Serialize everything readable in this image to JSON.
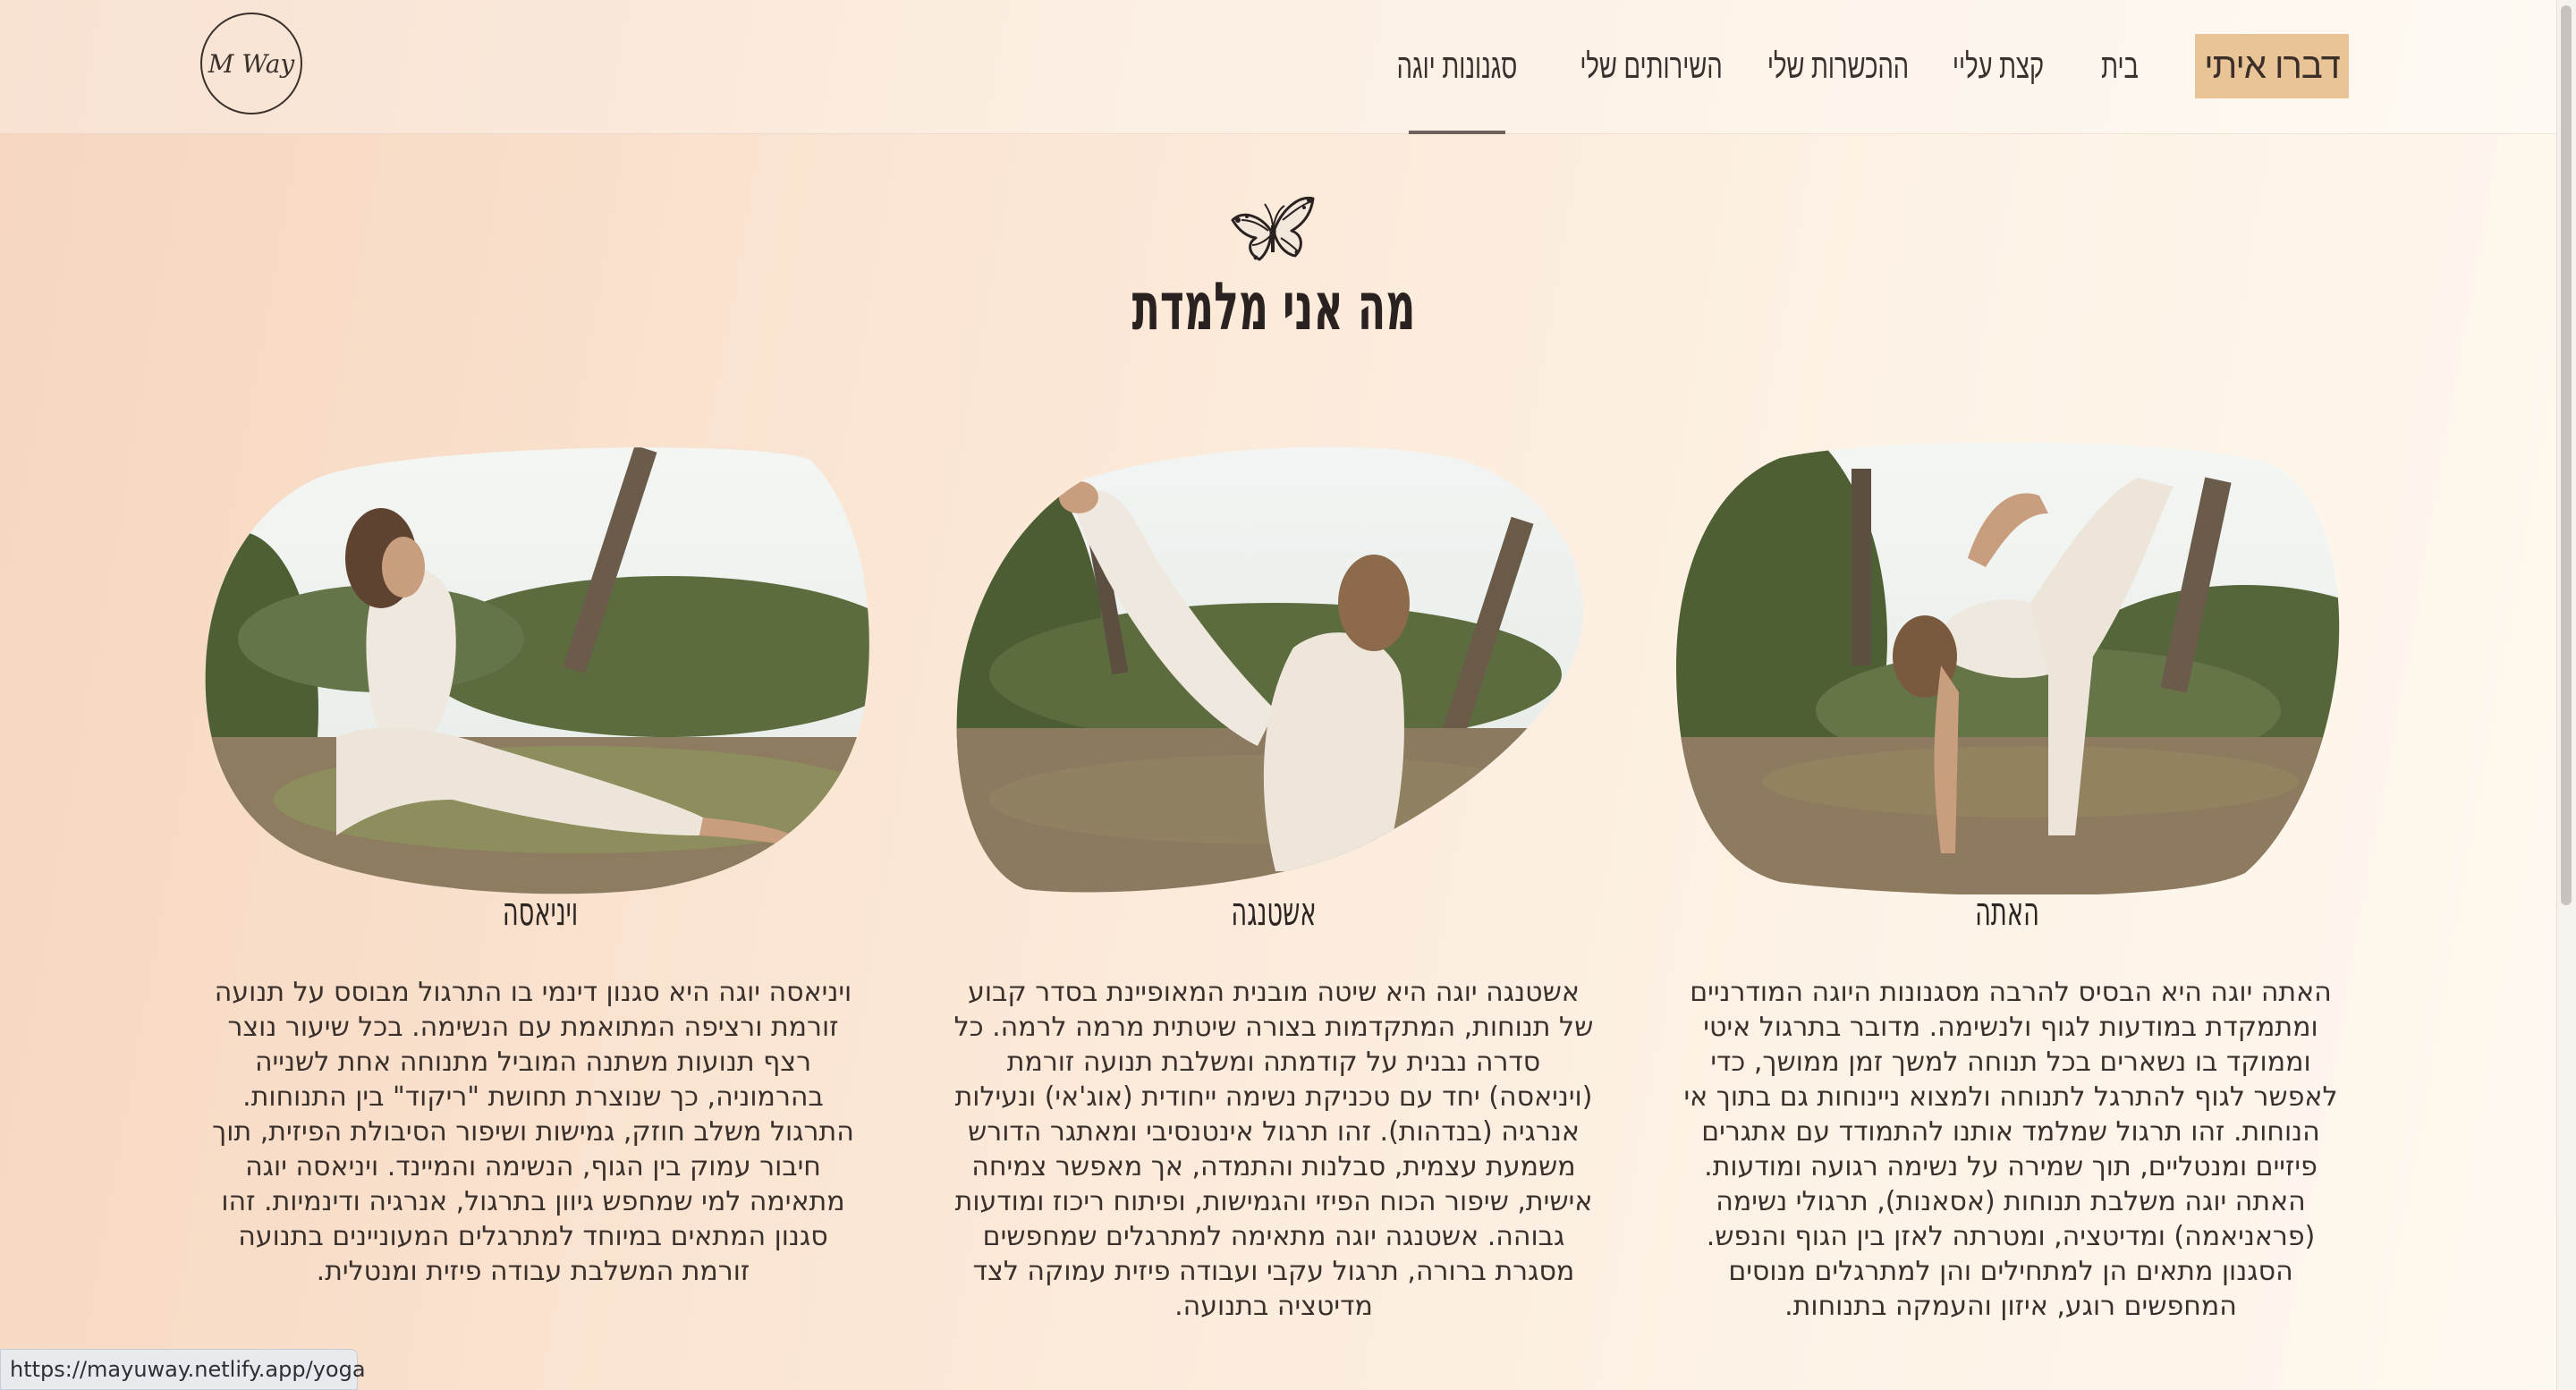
{
  "header": {
    "logo_text": "M Way",
    "cta_label": "דברו איתי",
    "nav": [
      {
        "label": "בית"
      },
      {
        "label": "קצת עליי"
      },
      {
        "label": "ההכשרות שלי"
      },
      {
        "label": "השירותים שלי"
      },
      {
        "label": "סגנונות יוגה",
        "active": true
      }
    ]
  },
  "section": {
    "title": "מה אני מלמדת",
    "icon": "butterfly-icon"
  },
  "cards": [
    {
      "title": "האתה",
      "image": "yoga-standing-pose-photo",
      "lines": [
        "האתה יוגה היא הבסיס להרבה מסגנונות היוגה המודרניים",
        "ומתמקדת במודעות לגוף ולנשימה. מדובר בתרגול איטי",
        "וממוקד בו נשארים בכל תנוחה למשך זמן ממושך, כדי",
        "לאפשר לגוף להתרגל לתנוחה ולמצוא ניינוחות גם בתוך אי",
        "הנוחות. זהו תרגול שמלמד אותנו להתמודד עם אתגרים",
        "פיזיים ומנטליים, תוך שמירה על נשימה רגועה ומודעות.",
        "האתה יוגה משלבת תנוחות (אסאנות), תרגולי נשימה",
        "(פראניאמה) ומדיטציה, ומטרתה לאזן בין הגוף והנפש.",
        "הסגנון מתאים הן למתחילים והן למתרגלים מנוסים",
        "המחפשים רוגע, איזון והעמקה בתנוחות."
      ]
    },
    {
      "title": "אשטנגה",
      "image": "yoga-leg-raise-photo",
      "lines": [
        "אשטנגה יוגה היא שיטה מובנית המאופיינת בסדר קבוע",
        "של תנוחות, המתקדמות בצורה שיטתית מרמה לרמה. כל",
        "סדרה נבנית על קודמתה ומשלבת תנועה זורמת",
        "(ויניאסה) יחד עם טכניקת נשימה ייחודית (אוג'אי) ונעילות",
        "אנרגיה (בנדהות). זהו תרגול אינטנסיבי ומאתגר הדורש",
        "משמעת עצמית, סבלנות והתמדה, אך מאפשר צמיחה",
        "אישית, שיפור הכוח הפיזי והגמישות, ופיתוח ריכוז ומודעות",
        "גבוהה. אשטנגה יוגה מתאימה למתרגלים שמחפשים",
        "מסגרת ברורה, תרגול עקבי ועבודה פיזית עמוקה לצד",
        "מדיטציה בתנועה."
      ]
    },
    {
      "title": "ויניאסה",
      "image": "yoga-lunge-twist-photo",
      "lines": [
        "ויניאסה יוגה היא סגנון דינמי בו התרגול מבוסס על תנועה",
        "זורמת ורציפה המתואמת עם הנשימה. בכל שיעור נוצר",
        "רצף תנועות משתנה המוביל מתנוחה אחת לשנייה",
        "בהרמוניה, כך שנוצרת תחושת \"ריקוד\" בין התנוחות.",
        "התרגול משלב חוזק, גמישות ושיפור הסיבולת הפיזית, תוך",
        "חיבור עמוק בין הגוף, הנשימה והמיינד. ויניאסה יוגה",
        "מתאימה למי שמחפש גיוון בתרגול, אנרגיה ודינמיות. זהו",
        "סגנון המתאים במיוחד למתרגלים המעוניינים בתנועה",
        "זורמת המשלבת עבודה פיזית ומנטלית."
      ]
    }
  ],
  "status_bar": {
    "url": "https://mayuway.netlify.app/yoga"
  },
  "colors": {
    "accent": "#e9c497",
    "text": "#2b2320",
    "background_start": "#f6d6be",
    "background_end": "#fef9ef"
  }
}
